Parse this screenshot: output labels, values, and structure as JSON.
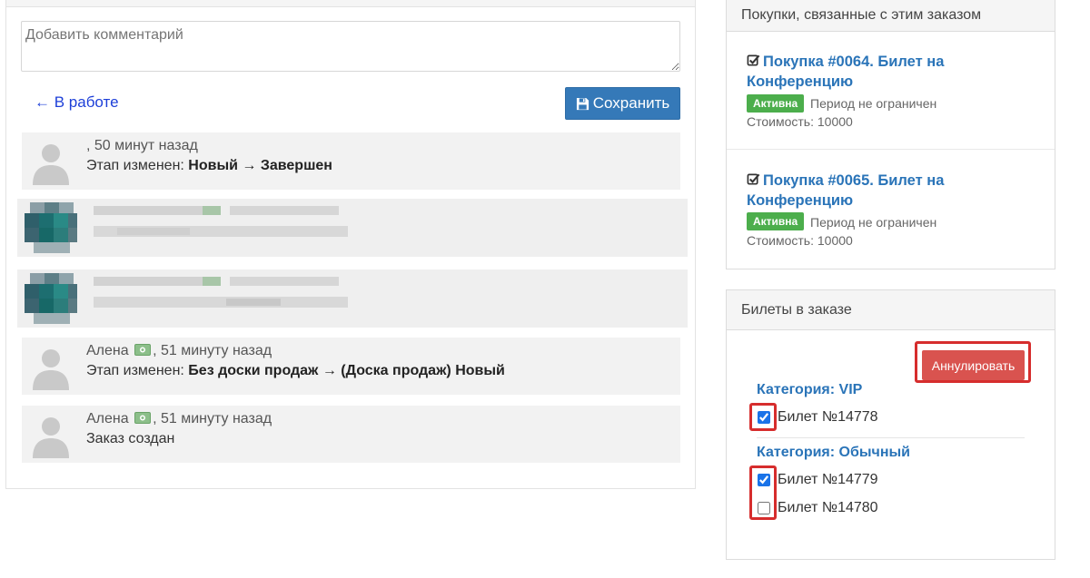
{
  "comment": {
    "placeholder": "Добавить комментарий"
  },
  "nav": {
    "back_label": "← В работе"
  },
  "save_button": {
    "label": "Сохранить"
  },
  "history": [
    {
      "author": "",
      "time": ", 50 минут назад",
      "prefix": "Этап изменен: ",
      "detail": "Новый → Завершен"
    },
    {
      "author": "Алена",
      "time": ", 51 минуту назад",
      "prefix": "Этап изменен: ",
      "detail": "Без доски продаж → (Доска продаж) Новый"
    },
    {
      "author": "Алена",
      "time": ", 51 минуту назад",
      "prefix": "",
      "detail": "Заказ создан"
    }
  ],
  "purchases": {
    "header": "Покупки, связанные с этим заказом",
    "items": [
      {
        "title": "Покупка #0064. Билет на Конференцию",
        "status": "Активна",
        "period": "Период не ограничен",
        "cost": "Стоимость: 10000"
      },
      {
        "title": "Покупка #0065. Билет на Конференцию",
        "status": "Активна",
        "period": "Период не ограничен",
        "cost": "Стоимость: 10000"
      }
    ]
  },
  "tickets": {
    "header": "Билеты в заказе",
    "annul_label": "Аннулировать",
    "categories": [
      {
        "title": "Категория: VIP",
        "tickets": [
          {
            "label": "Билет №14778",
            "checked": true
          }
        ]
      },
      {
        "title": "Категория: Обычный",
        "tickets": [
          {
            "label": "Билет №14779",
            "checked": true
          },
          {
            "label": "Билет №14780",
            "checked": false
          }
        ]
      }
    ]
  },
  "colors": {
    "primary_button": "#3579b8",
    "danger_button": "#d9534f",
    "active_badge": "#4cae4c",
    "link": "#2a74b8",
    "highlight_outline": "#d62d2d"
  },
  "icons": [
    "floppy-disk-icon",
    "check-square-icon",
    "money-icon",
    "user-silhouette-icon"
  ]
}
